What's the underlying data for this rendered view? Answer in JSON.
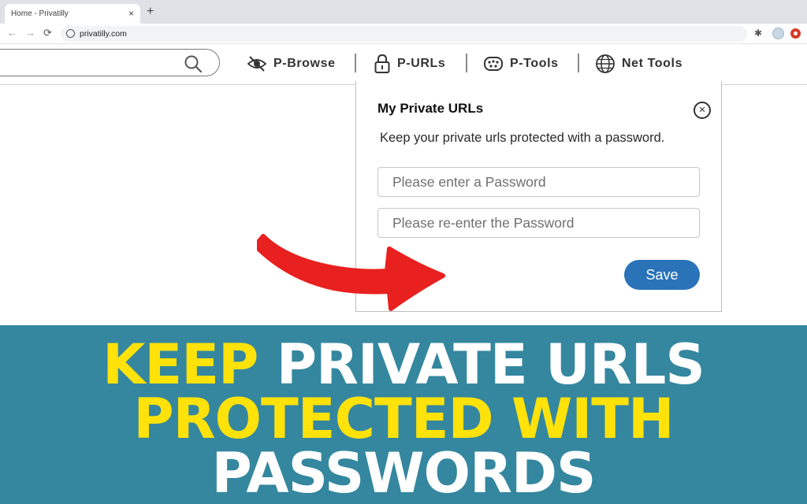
{
  "browser": {
    "tab_title": "Home - Privatilly",
    "tab_close": "×",
    "new_tab": "+",
    "back": "←",
    "forward": "→",
    "reload": "⟳",
    "url": "privatilly.com"
  },
  "site_nav": {
    "search_placeholder": "",
    "items": [
      {
        "label": "P-Browse",
        "icon": "eye-slash-icon"
      },
      {
        "label": "P-URLs",
        "icon": "lock-icon"
      },
      {
        "label": "P-Tools",
        "icon": "tools-icon"
      },
      {
        "label": "Net Tools",
        "icon": "globe-icon"
      }
    ]
  },
  "modal": {
    "title": "My Private URLs",
    "close": "×",
    "description": "Keep your private urls protected with a password.",
    "password_placeholder": "Please enter a Password",
    "confirm_placeholder": "Please re-enter the Password",
    "save_label": "Save"
  },
  "banner": {
    "line1_highlight": "KEEP",
    "line1_rest": " PRIVATE URLS",
    "line2_highlight": "PROTECTED WITH",
    "line3": "PASSWORDS"
  },
  "colors": {
    "banner_bg": "#34879f",
    "highlight": "#ffe20a",
    "save_button": "#2a73b8",
    "arrow": "#e8201f"
  }
}
